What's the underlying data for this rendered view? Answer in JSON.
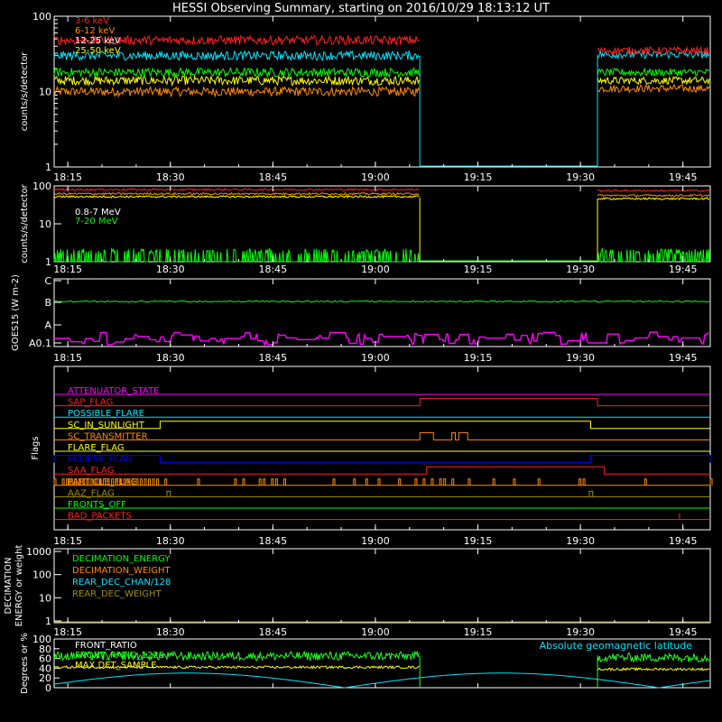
{
  "title": "HESSI Observing Summary, starting on 2016/10/29 18:13:12 UT",
  "colors": {
    "background": "#000000",
    "frame": "#ffffff",
    "red": "#ff2020",
    "orange": "#ff8c00",
    "cyan": "#00e5ff",
    "green": "#00ff00",
    "yellow": "#ffff00",
    "magenta": "#ff00ff",
    "blue": "#0000ff",
    "olive": "#a09000",
    "bright_green": "#22ff22"
  },
  "time_ticks": [
    "18:15",
    "18:30",
    "18:45",
    "19:00",
    "19:15",
    "19:30",
    "19:45"
  ],
  "chart_data": [
    {
      "type": "line",
      "panel": "count-rates-low",
      "ylabel": "counts/s/detector",
      "yscale": "log",
      "ylim": [
        1,
        100
      ],
      "ytick_labels": [
        "1",
        "10",
        "100"
      ],
      "xlim_minutes": [
        0,
        60
      ],
      "data_gap_minutes": [
        53.5,
        79.5
      ],
      "legend": [
        "3-6 keV",
        "6-12 keV",
        "12-25 keV",
        "25-50 keV"
      ],
      "series": [
        {
          "name": "3-6 keV",
          "color": "#ff2020",
          "level_before": 48,
          "level_after": 35
        },
        {
          "name": "6-12 keV",
          "color": "#00e5ff",
          "level_before": 30,
          "level_after": 31
        },
        {
          "name": "12-25 keV",
          "color": "#00ff00",
          "level_before": 18,
          "level_after": 18
        },
        {
          "name": "25-50 keV",
          "color": "#ffff00",
          "level_before": 14,
          "level_after": 14
        },
        {
          "name": "",
          "color": "#ff8c00",
          "level_before": 10,
          "level_after": 11
        }
      ]
    },
    {
      "type": "line",
      "panel": "count-rates-high",
      "ylabel": "counts/s/detector",
      "yscale": "log",
      "ylim": [
        1,
        100
      ],
      "ytick_labels": [
        "1",
        "10",
        "100"
      ],
      "legend": [
        "0.8-7 MeV",
        "7-20 MeV"
      ],
      "series": [
        {
          "name": "",
          "color": "#ff2020",
          "level_before": 80,
          "level_after": 75
        },
        {
          "name": "",
          "color": "#ff8c00",
          "level_before": 62,
          "level_after": 56
        },
        {
          "name": "0.8-7 MeV",
          "color": "#ffff00",
          "level_before": 52,
          "level_after": 46
        },
        {
          "name": "7-20 MeV",
          "color": "#00ff00",
          "level_before": 1.3,
          "level_after": 1.3
        }
      ]
    },
    {
      "type": "line",
      "panel": "goes",
      "ylabel": "GOES15 (W m-2)",
      "ytick_labels": [
        "A0.1",
        "A",
        "B",
        "C"
      ],
      "series": [
        {
          "name": "",
          "color": "#00ff00",
          "level": "B"
        },
        {
          "name": "",
          "color": "#ff00ff",
          "level": "A0.1-A"
        }
      ]
    },
    {
      "type": "table",
      "panel": "flags",
      "ylabel": "Flags",
      "rows": [
        {
          "name": "ATTENUATOR_STATE",
          "color": "#ff00ff",
          "segments": []
        },
        {
          "name": "SAP_FLAG",
          "color": "#ff2020",
          "segments": [
            [
              53.5,
              79.5
            ]
          ]
        },
        {
          "name": "POSSIBLE_FLARE",
          "color": "#00e5ff",
          "segments": []
        },
        {
          "name": "SC_IN_SUNLIGHT",
          "color": "#ffff00",
          "segments": [
            [
              15.5,
              78.5
            ]
          ]
        },
        {
          "name": "SC_TRANSMITTER",
          "color": "#ff8c00",
          "segments": [
            [
              53.5,
              55.5
            ],
            [
              58.2,
              58.7
            ],
            [
              59.2,
              60.5
            ]
          ]
        },
        {
          "name": "FLARE_FLAG",
          "color": "#ffff00",
          "segments": []
        },
        {
          "name": "ECLIPSE_FLAG",
          "color": "#0000ff",
          "segments": [
            [
              0,
              15.5
            ],
            [
              78.5,
              96
            ]
          ]
        },
        {
          "name": "SAA_FLAG",
          "color": "#ff2020",
          "segments": [
            [
              54.5,
              80.5
            ]
          ]
        },
        {
          "name": "PARTICLE_FLAG",
          "color": "#ff8c00",
          "segments": []
        },
        {
          "name": "AAZ_FLAG",
          "color": "#a09000",
          "segments": []
        },
        {
          "name": "FRONTS_OFF",
          "color": "#00ff00",
          "segments": []
        },
        {
          "name": "BAD_PACKETS",
          "color": "#ff2020",
          "segments": []
        }
      ]
    },
    {
      "type": "line",
      "panel": "decimation",
      "ylabel": "DECIMATION ENERGY or weight",
      "yscale": "log",
      "ytick_labels": [
        "1",
        "10",
        "100",
        "1000"
      ],
      "legend": [
        "DECIMATION_ENERGY",
        "DECIMATION_WEIGHT",
        "REAR_DEC_CHAN/128",
        "REAR_DEC_WEIGHT"
      ],
      "series": [
        {
          "name": "DECIMATION_ENERGY",
          "color": "#00ff00"
        },
        {
          "name": "DECIMATION_WEIGHT",
          "color": "#ff8c00"
        },
        {
          "name": "REAR_DEC_CHAN/128",
          "color": "#00e5ff"
        },
        {
          "name": "REAR_DEC_WEIGHT",
          "color": "#a09000"
        }
      ]
    },
    {
      "type": "line",
      "panel": "ratios",
      "ylabel": "Degrees or %",
      "ylim": [
        0,
        100
      ],
      "ytick_labels": [
        "0",
        "20",
        "40",
        "60",
        "80",
        "100"
      ],
      "legend": [
        "FRONT_RATIO",
        "FRONT_RATIO_1225",
        "MAX DET_SAMPLE"
      ],
      "annotation": "Absolute geomagnetic latitude",
      "series": [
        {
          "name": "FRONT_RATIO",
          "color": "#22ff22",
          "level_before": 65,
          "level_after": 62
        },
        {
          "name": "MAX DET_SAMPLE",
          "color": "#ffff00",
          "level_before": 42,
          "level_after": 38
        },
        {
          "name": "Absolute geomagnetic latitude",
          "color": "#00e5ff"
        }
      ]
    }
  ]
}
